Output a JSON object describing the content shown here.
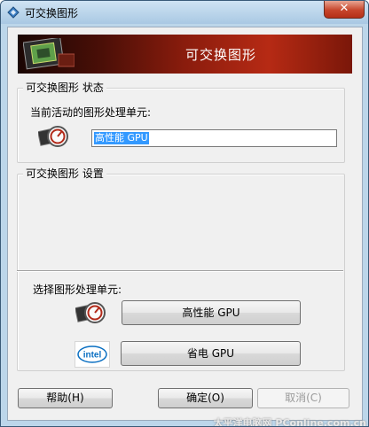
{
  "window": {
    "title": "可交换图形",
    "close_glyph": "✕"
  },
  "banner": {
    "title": "可交换图形"
  },
  "status_group": {
    "label": "可交换图形 状态",
    "current_label": "当前活动的图形处理单元:",
    "current_value": "高性能 GPU"
  },
  "settings_group": {
    "label": "可交换图形 设置",
    "select_label": "选择图形处理单元:",
    "high_perf_button": "高性能 GPU",
    "power_save_button": "省电 GPU"
  },
  "footer": {
    "help_button": "帮助(H)",
    "ok_button": "确定(O)",
    "cancel_button": "取消(C)"
  },
  "watermark": "太平洋电脑网 PConline.com.cn",
  "icons": [
    "app-icon",
    "close-icon",
    "chip-icon",
    "amd-gpu-icon",
    "intel-logo-icon"
  ],
  "colors": {
    "banner_red": "#8a1c0d",
    "selection_blue": "#3399ff",
    "title_bar": "#bcd6ea"
  }
}
